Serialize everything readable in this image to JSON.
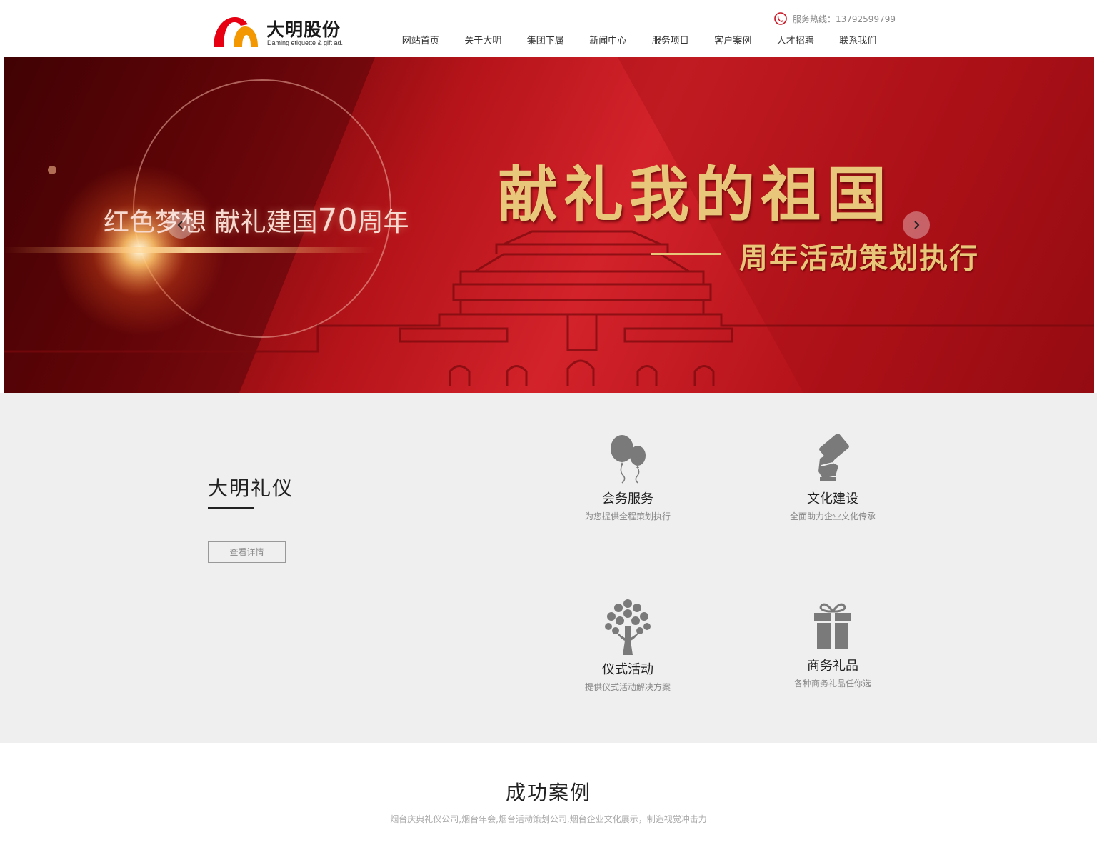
{
  "header": {
    "logo_cn": "大明股份",
    "logo_en": "Daming etiquette & gift ad.",
    "hotline": "服务热线：13792599799",
    "nav": [
      "网站首页",
      "关于大明",
      "集团下属",
      "新闻中心",
      "服务项目",
      "客户案例",
      "人才招聘",
      "联系我们"
    ]
  },
  "banner": {
    "subtitle_a": "红色梦想 献礼建国",
    "subtitle_num": "70",
    "subtitle_b": "周年",
    "title": "献礼我的祖国",
    "tagline": "周年活动策划执行",
    "colors": {
      "red": "#d3222a",
      "gold": "#e8c77a"
    }
  },
  "services": {
    "title": "大明礼仪",
    "detail_button": "查看详情",
    "cards": [
      {
        "title": "会务服务",
        "desc": "为您提供全程策划执行",
        "icon": "balloons-icon"
      },
      {
        "title": "文化建设",
        "desc": "全面助力企业文化传承",
        "icon": "card-hand-icon"
      },
      {
        "title": "仪式活动",
        "desc": "提供仪式活动解决方案",
        "icon": "tree-icon"
      },
      {
        "title": "商务礼品",
        "desc": "各种商务礼品任你选",
        "icon": "gift-icon"
      }
    ]
  },
  "cases": {
    "title": "成功案例",
    "subtitle": "烟台庆典礼仪公司,烟台年会,烟台活动策划公司,烟台企业文化展示，制造视觉冲击力"
  }
}
